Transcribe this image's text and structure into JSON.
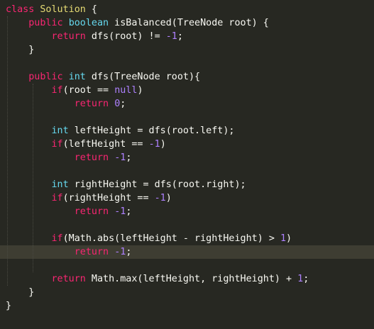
{
  "editor": {
    "top_fragment": "/",
    "lines": [
      [
        {
          "t": "class",
          "c": "kw"
        },
        {
          "t": " ",
          "c": "pl"
        },
        {
          "t": "Solution",
          "c": "cl"
        },
        {
          "t": " {",
          "c": "pl"
        }
      ],
      [
        {
          "t": "    ",
          "c": "ind"
        },
        {
          "t": "public",
          "c": "kw"
        },
        {
          "t": " ",
          "c": "pl"
        },
        {
          "t": "boolean",
          "c": "st"
        },
        {
          "t": " isBalanced(TreeNode root) {",
          "c": "pl"
        }
      ],
      [
        {
          "t": "        ",
          "c": "ind"
        },
        {
          "t": "return",
          "c": "kw"
        },
        {
          "t": " dfs(root) != ",
          "c": "pl"
        },
        {
          "t": "-1",
          "c": "num"
        },
        {
          "t": ";",
          "c": "pl"
        }
      ],
      [
        {
          "t": "    }",
          "c": "pl"
        }
      ],
      [],
      [
        {
          "t": "    ",
          "c": "ind"
        },
        {
          "t": "public",
          "c": "kw"
        },
        {
          "t": " ",
          "c": "pl"
        },
        {
          "t": "int",
          "c": "st"
        },
        {
          "t": " dfs(TreeNode root){",
          "c": "pl"
        }
      ],
      [
        {
          "t": "        ",
          "c": "ind"
        },
        {
          "t": "if",
          "c": "kw"
        },
        {
          "t": "(root == ",
          "c": "pl"
        },
        {
          "t": "null",
          "c": "num"
        },
        {
          "t": ")",
          "c": "pl"
        }
      ],
      [
        {
          "t": "            ",
          "c": "ind"
        },
        {
          "t": "return",
          "c": "kw"
        },
        {
          "t": " ",
          "c": "pl"
        },
        {
          "t": "0",
          "c": "num"
        },
        {
          "t": ";",
          "c": "pl"
        }
      ],
      [],
      [
        {
          "t": "        ",
          "c": "ind"
        },
        {
          "t": "int",
          "c": "st"
        },
        {
          "t": " leftHeight = dfs(root.left);",
          "c": "pl"
        }
      ],
      [
        {
          "t": "        ",
          "c": "ind"
        },
        {
          "t": "if",
          "c": "kw"
        },
        {
          "t": "(leftHeight == ",
          "c": "pl"
        },
        {
          "t": "-1",
          "c": "num"
        },
        {
          "t": ")",
          "c": "pl"
        }
      ],
      [
        {
          "t": "            ",
          "c": "ind"
        },
        {
          "t": "return",
          "c": "kw"
        },
        {
          "t": " ",
          "c": "pl"
        },
        {
          "t": "-1",
          "c": "num"
        },
        {
          "t": ";",
          "c": "pl"
        }
      ],
      [],
      [
        {
          "t": "        ",
          "c": "ind"
        },
        {
          "t": "int",
          "c": "st"
        },
        {
          "t": " rightHeight = dfs(root.right);",
          "c": "pl"
        }
      ],
      [
        {
          "t": "        ",
          "c": "ind"
        },
        {
          "t": "if",
          "c": "kw"
        },
        {
          "t": "(rightHeight == ",
          "c": "pl"
        },
        {
          "t": "-1",
          "c": "num"
        },
        {
          "t": ")",
          "c": "pl"
        }
      ],
      [
        {
          "t": "            ",
          "c": "ind"
        },
        {
          "t": "return",
          "c": "kw"
        },
        {
          "t": " ",
          "c": "pl"
        },
        {
          "t": "-1",
          "c": "num"
        },
        {
          "t": ";",
          "c": "pl"
        }
      ],
      [],
      [
        {
          "t": "        ",
          "c": "ind"
        },
        {
          "t": "if",
          "c": "kw"
        },
        {
          "t": "(Math.abs(leftHeight - rightHeight) > ",
          "c": "pl"
        },
        {
          "t": "1",
          "c": "num"
        },
        {
          "t": ")",
          "c": "pl"
        }
      ],
      [
        {
          "t": "            ",
          "c": "ind"
        },
        {
          "t": "return",
          "c": "kw"
        },
        {
          "t": " ",
          "c": "pl"
        },
        {
          "t": "-1",
          "c": "num"
        },
        {
          "t": ";",
          "c": "pl"
        }
      ],
      [],
      [
        {
          "t": "        ",
          "c": "ind"
        },
        {
          "t": "return",
          "c": "kw"
        },
        {
          "t": " Math.max(leftHeight, rightHeight) + ",
          "c": "pl"
        },
        {
          "t": "1",
          "c": "num"
        },
        {
          "t": ";",
          "c": "pl"
        }
      ],
      [
        {
          "t": "    }",
          "c": "pl"
        }
      ],
      [
        {
          "t": "}",
          "c": "pl"
        }
      ]
    ],
    "active_line_index": 18,
    "colors": {
      "background": "#272822",
      "active_line": "#3e3d32",
      "keyword": "#f92672",
      "type": "#66d9ef",
      "class_name": "#e6db74",
      "number": "#ae81ff",
      "text": "#f8f8f2"
    }
  }
}
